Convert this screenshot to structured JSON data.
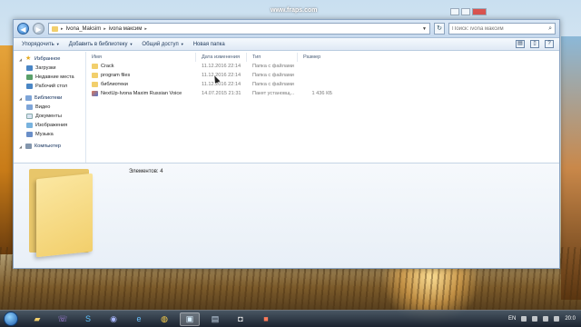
{
  "overlay": {
    "watermark": "www.fraps.com"
  },
  "addressbar": {
    "back_glyph": "◀",
    "forward_glyph": "▶",
    "path": [
      "Ivona_Maksim",
      "ivona максим"
    ],
    "search_placeholder": "Поиск: ivona максим",
    "search_icon": "search-icon"
  },
  "toolbar": {
    "organize": "Упорядочить",
    "add_to_library": "Добавить в библиотеку",
    "share": "Общий доступ",
    "new_folder": "Новая папка"
  },
  "nav": {
    "favorites": {
      "label": "Избранное",
      "items": [
        "Загрузки",
        "Недавние места",
        "Рабочий стол"
      ]
    },
    "libraries": {
      "label": "Библиотеки",
      "items": [
        "Видео",
        "Документы",
        "Изображения",
        "Музыка"
      ]
    },
    "computer": {
      "label": "Компьютер"
    }
  },
  "columns": [
    "Имя",
    "Дата изменения",
    "Тип",
    "Размер"
  ],
  "files": [
    {
      "name": "Crack",
      "date": "11.12.2016 22:14",
      "type": "Папка с файлами",
      "size": "",
      "icon": "folder-icon"
    },
    {
      "name": "program files",
      "date": "11.12.2016 22:14",
      "type": "Папка с файлами",
      "size": "",
      "icon": "folder-icon"
    },
    {
      "name": "библиотеки",
      "date": "11.12.2016 22:14",
      "type": "Папка с файлами",
      "size": "",
      "icon": "folder-icon"
    },
    {
      "name": "NextUp-Ivona Maxim Russian Voice",
      "date": "14.07.2015 21:31",
      "type": "Пакет установщ...",
      "size": "1 436 КБ",
      "icon": "installer-icon"
    }
  ],
  "details": {
    "count_text": "Элементов: 4"
  },
  "taskbar": {
    "apps": [
      "explorer-icon",
      "viber-icon",
      "skype-icon",
      "discord-icon",
      "ie-icon",
      "chrome-icon",
      "image-viewer-icon",
      "media-icon",
      "camera-icon",
      "recorder-icon"
    ],
    "lang": "EN",
    "time": "20:0"
  }
}
